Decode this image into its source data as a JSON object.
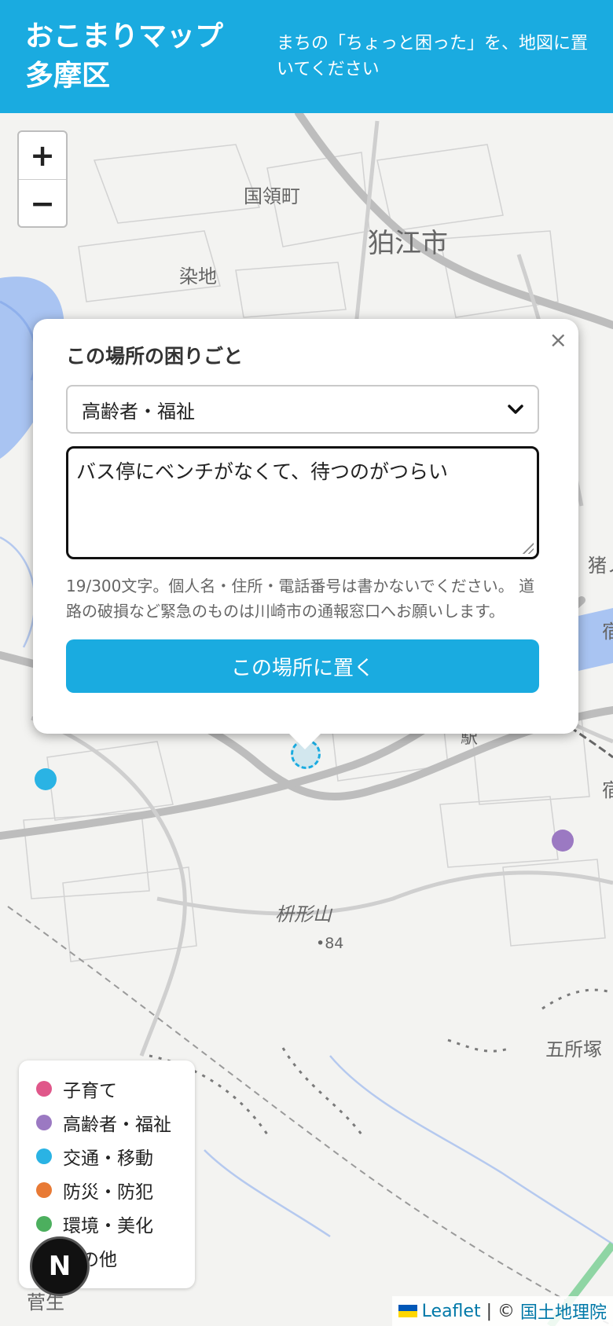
{
  "header": {
    "title": "おこまりマップ 多摩区",
    "tagline": "まちの「ちょっと困った」を、地図に置いてください"
  },
  "zoom": {
    "in_label": "+",
    "out_label": "−"
  },
  "map_labels": {
    "kokuryo": "国領町",
    "komae": "狛江市",
    "someji": "染地",
    "noborito": "登戸駅",
    "masugata": "枡形山",
    "elevation": "•84",
    "goshozuka": "五所塚",
    "sugao": "菅生",
    "inoka": "猪ノ",
    "right_edge_1": "宿",
    "right_edge_2": "宿"
  },
  "popup": {
    "close_label": "×",
    "title": "この場所の困りごと",
    "category_selected": "高齢者・福祉",
    "chevron": "⌄",
    "text_value": "バス停にベンチがなくて、待つのがつらい",
    "note": "19/300文字。個人名・住所・電話番号は書かないでください。 道路の破損など緊急のものは川崎市の通報窓口へお願いします。",
    "submit_label": "この場所に置く"
  },
  "markers": [
    {
      "category": "交通・移動",
      "color": "#2ab3e4"
    },
    {
      "category": "高齢者・福祉",
      "color": "#9b79c2"
    },
    {
      "category": "draft",
      "color": "#1aabe0"
    }
  ],
  "legend": {
    "items": [
      {
        "label": "子育て",
        "color": "#e0578a"
      },
      {
        "label": "高齢者・福祉",
        "color": "#9b79c2"
      },
      {
        "label": "交通・移動",
        "color": "#2ab3e4"
      },
      {
        "label": "防災・防犯",
        "color": "#e87a35"
      },
      {
        "label": "環境・美化",
        "color": "#4caf5e"
      },
      {
        "label": "その他",
        "color": "#555555"
      }
    ]
  },
  "badge": {
    "label": "N"
  },
  "attribution": {
    "leaflet": "Leaflet",
    "separator": " | © ",
    "gsi": "国土地理院"
  },
  "colors": {
    "brand": "#1aabe0"
  }
}
